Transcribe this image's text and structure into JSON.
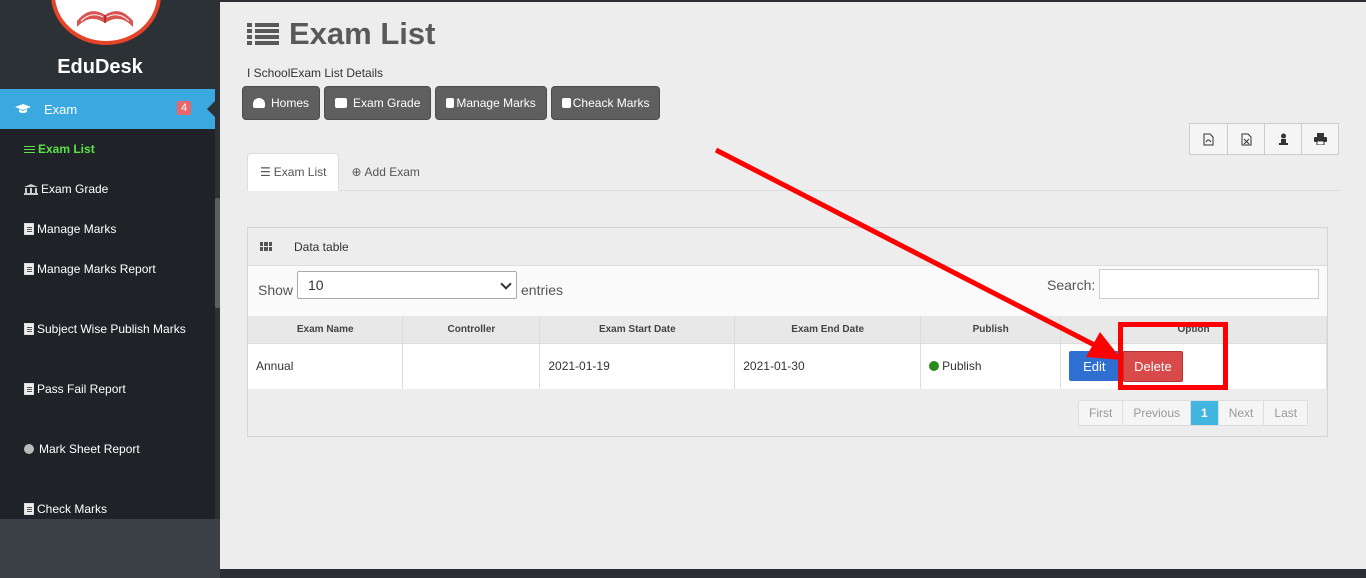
{
  "app": {
    "brand": "EduDesk"
  },
  "sidebar": {
    "active": {
      "label": "Exam",
      "badge": "4"
    },
    "items": [
      {
        "label": "Exam List",
        "icon": "list-icon"
      },
      {
        "label": "Exam Grade",
        "icon": "bank-icon"
      },
      {
        "label": "Manage Marks",
        "icon": "document-icon"
      },
      {
        "label": "Manage Marks Report",
        "icon": "document-icon"
      },
      {
        "label": "Subject Wise Publish Marks",
        "icon": "document-icon"
      },
      {
        "label": "Pass Fail Report",
        "icon": "document-icon"
      },
      {
        "label": "Mark Sheet Report",
        "icon": "circle-icon"
      },
      {
        "label": "Check Marks",
        "icon": "document-icon"
      }
    ]
  },
  "page": {
    "title": "Exam List",
    "subtitle": "I SchoolExam List Details"
  },
  "toolbar": {
    "homes": "Homes",
    "exam_grade": "Exam Grade",
    "manage_marks": "Manage Marks",
    "check_marks": "Cheack Marks"
  },
  "export": [
    "pdf-icon",
    "excel-icon",
    "download-icon",
    "print-icon"
  ],
  "tabs": {
    "list": "Exam List",
    "add": "Add Exam"
  },
  "panel": {
    "title": "Data table",
    "show_label": "Show",
    "page_size": "10",
    "entries_label": "entries",
    "search_label": "Search:",
    "search_value": ""
  },
  "table": {
    "headers": [
      "Exam Name",
      "Controller",
      "Exam Start Date",
      "Exam End Date",
      "Publish",
      "Option"
    ],
    "rows": [
      {
        "name": "Annual",
        "controller": "",
        "start": "2021-01-19",
        "end": "2021-01-30",
        "publish": "Publish",
        "edit": "Edit",
        "delete": "Delete"
      }
    ]
  },
  "pagination": {
    "first": "First",
    "previous": "Previous",
    "current": "1",
    "next": "Next",
    "last": "Last"
  },
  "colors": {
    "accent": "#3aa9e0",
    "active_sub": "#5ce14a",
    "danger": "#d84a4a",
    "primary": "#2f6fd2",
    "annotation": "#ff0000"
  }
}
